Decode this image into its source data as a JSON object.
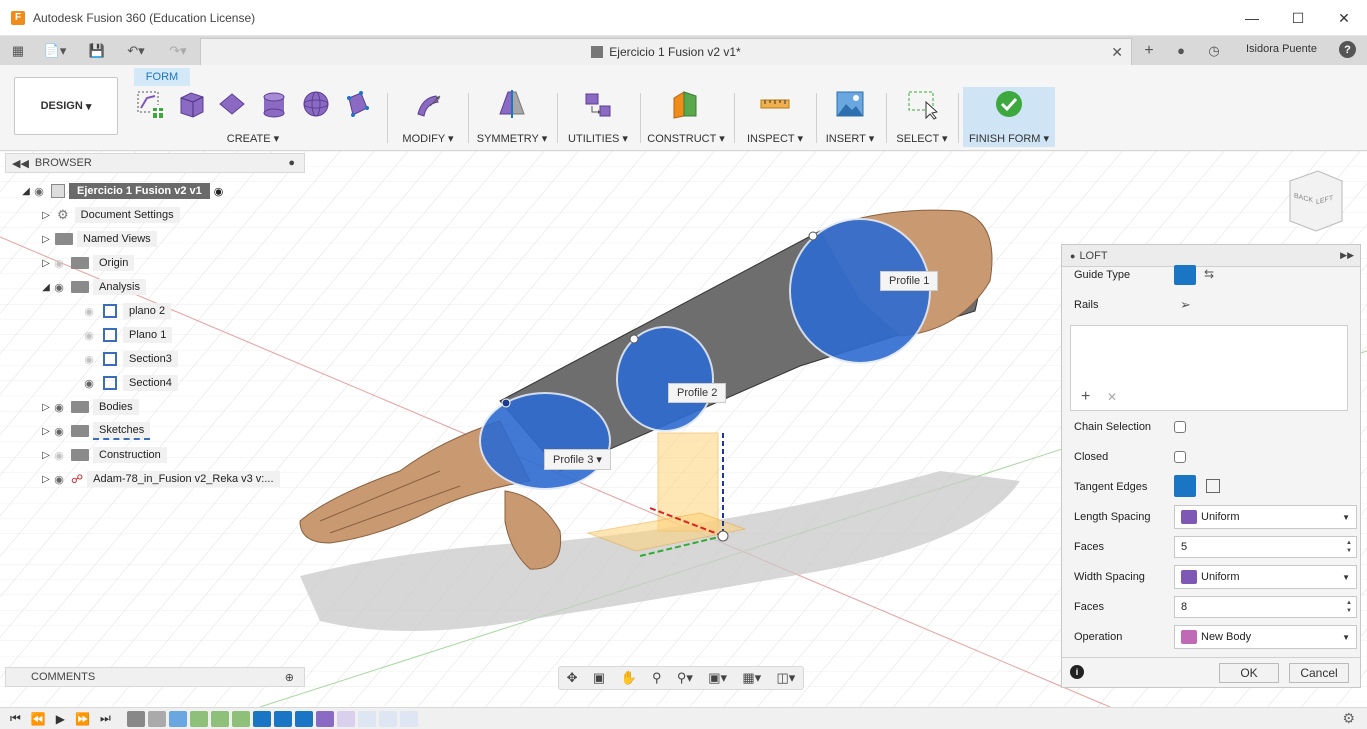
{
  "window": {
    "title": "Autodesk Fusion 360 (Education License)",
    "logo": "F"
  },
  "tab": {
    "title": "Ejercicio 1 Fusion v2 v1*",
    "user": "Isidora Puente",
    "help": "?"
  },
  "ribbon": {
    "active_tab": "FORM",
    "workspace": "DESIGN",
    "groups": {
      "create": "CREATE",
      "modify": "MODIFY",
      "symmetry": "SYMMETRY",
      "utilities": "UTILITIES",
      "construct": "CONSTRUCT",
      "inspect": "INSPECT",
      "insert": "INSERT",
      "select": "SELECT",
      "finish": "FINISH FORM"
    }
  },
  "browser": {
    "title": "BROWSER",
    "root": "Ejercicio 1 Fusion v2 v1",
    "items": {
      "document_settings": "Document Settings",
      "named_views": "Named Views",
      "origin": "Origin",
      "analysis": "Analysis",
      "plano2": "plano 2",
      "plano1": "Plano 1",
      "section3": "Section3",
      "section4": "Section4",
      "bodies": "Bodies",
      "sketches": "Sketches",
      "construction": "Construction",
      "component": "Adam-78_in_Fusion v2_Reka v3 v:..."
    }
  },
  "comments": {
    "title": "COMMENTS"
  },
  "canvas": {
    "profile1": "Profile 1",
    "profile2": "Profile 2",
    "profile3": "Profile 3",
    "viewcube_left": "LEFT",
    "viewcube_back": "BACK"
  },
  "loft": {
    "title": "LOFT",
    "guide_type_label": "Guide Type",
    "rails_label": "Rails",
    "chain_selection_label": "Chain Selection",
    "closed_label": "Closed",
    "tangent_edges_label": "Tangent Edges",
    "length_spacing_label": "Length Spacing",
    "length_spacing_value": "Uniform",
    "faces1_label": "Faces",
    "faces1_value": "5",
    "width_spacing_label": "Width Spacing",
    "width_spacing_value": "Uniform",
    "faces2_label": "Faces",
    "faces2_value": "8",
    "operation_label": "Operation",
    "operation_value": "New Body",
    "ok": "OK",
    "cancel": "Cancel"
  },
  "colors": {
    "accent": "#1a76c4",
    "profile_blue": "#2d6bd1",
    "skin": "#c99a72",
    "finish_bg": "#cfe5f5"
  }
}
